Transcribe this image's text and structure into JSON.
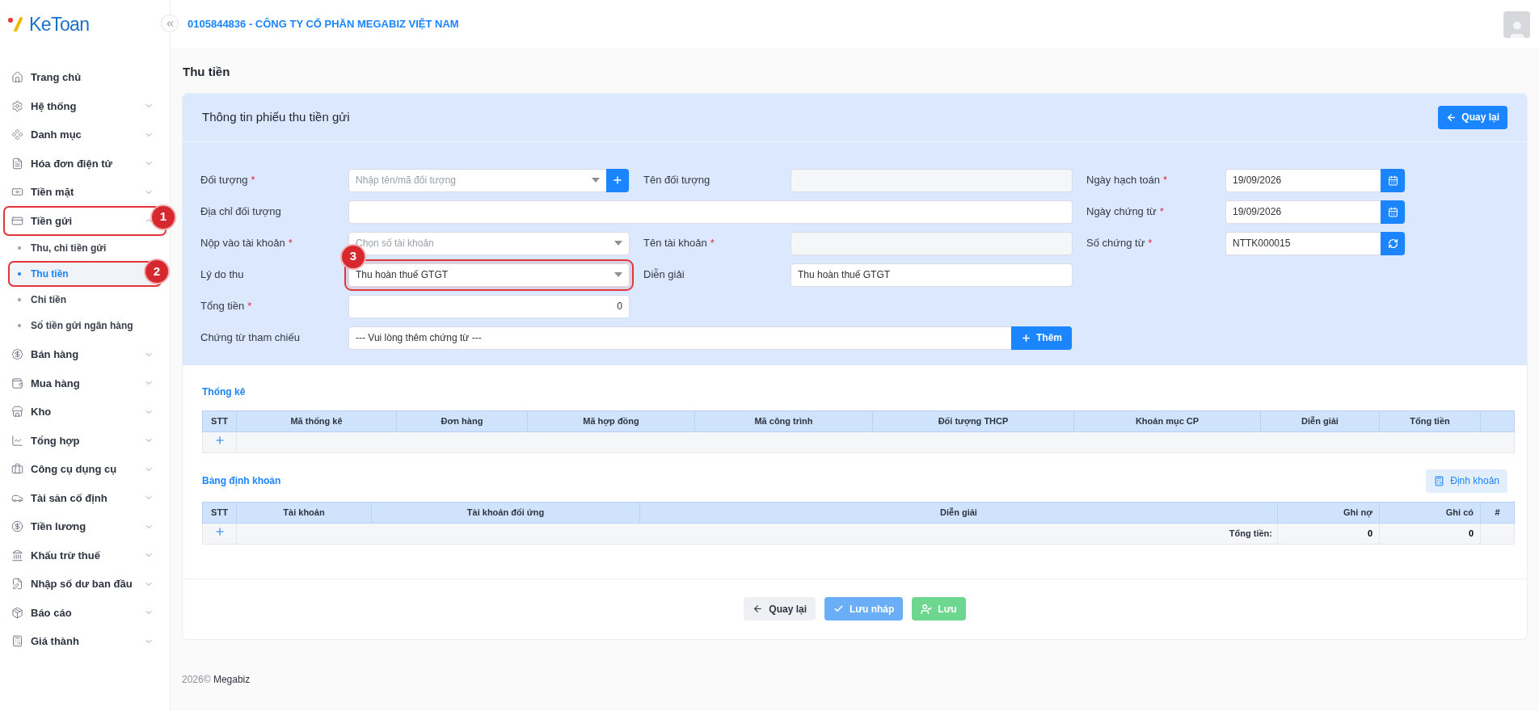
{
  "brand": {
    "name": "KeToan"
  },
  "header": {
    "company": "0105844836 - CÔNG TY CỔ PHẦN MEGABIZ VIỆT NAM"
  },
  "sidebar": {
    "items": [
      {
        "label": "Trang chủ"
      },
      {
        "label": "Hệ thống",
        "expanded": false
      },
      {
        "label": "Danh mục",
        "expanded": false
      },
      {
        "label": "Hóa đơn điện tử",
        "expanded": false
      },
      {
        "label": "Tiền mặt",
        "expanded": false
      },
      {
        "label": "Tiền gửi",
        "expanded": true,
        "callout": "1",
        "children": [
          {
            "label": "Thu, chi tiền gửi",
            "selected": false
          },
          {
            "label": "Thu tiền",
            "selected": true,
            "callout": "2"
          },
          {
            "label": "Chi tiền",
            "selected": false
          },
          {
            "label": "Sổ tiền gửi ngân hàng",
            "selected": false
          }
        ]
      },
      {
        "label": "Bán hàng",
        "expanded": false
      },
      {
        "label": "Mua hàng",
        "expanded": false
      },
      {
        "label": "Kho",
        "expanded": false
      },
      {
        "label": "Tổng hợp",
        "expanded": false
      },
      {
        "label": "Công cụ dụng cụ",
        "expanded": false
      },
      {
        "label": "Tài sản cố định",
        "expanded": false
      },
      {
        "label": "Tiền lương",
        "expanded": false
      },
      {
        "label": "Khấu trừ thuế",
        "expanded": false
      },
      {
        "label": "Nhập số dư ban đầu",
        "expanded": false
      },
      {
        "label": "Báo cáo",
        "expanded": false
      },
      {
        "label": "Giá thành",
        "expanded": false
      }
    ]
  },
  "page_title": "Thu tiền",
  "card": {
    "title": "Thông tin phiếu thu tiền gửi",
    "back_button": "Quay lại"
  },
  "required_mark": "*",
  "form": {
    "doi_tuong": {
      "label": "Đối tượng",
      "required": true,
      "placeholder": "Nhập tên/mã đối tượng"
    },
    "ten_doi_tuong": {
      "label": "Tên đối tượng",
      "required": false
    },
    "ngay_hach_toan": {
      "label": "Ngày hạch toán",
      "required": true,
      "value": "19/09/2026"
    },
    "dia_chi": {
      "label": "Địa chỉ đối tượng",
      "required": false
    },
    "ngay_chung_tu": {
      "label": "Ngày chứng từ",
      "required": true,
      "value": "19/09/2026"
    },
    "nop_vao": {
      "label": "Nộp vào tài khoản",
      "required": true,
      "placeholder": "Chọn số tài khoản"
    },
    "ten_tai_khoan": {
      "label": "Tên tài khoản",
      "required": true
    },
    "so_chung_tu": {
      "label": "Số chứng từ",
      "required": true,
      "value": "NTTK000015"
    },
    "ly_do": {
      "label": "Lý do thu",
      "required": false,
      "value": "Thu hoàn thuế GTGT",
      "callout": "3"
    },
    "dien_giai": {
      "label": "Diễn giải",
      "required": false,
      "value": "Thu hoàn thuế GTGT"
    },
    "tong_tien": {
      "label": "Tổng tiền",
      "required": true,
      "value": "0"
    },
    "chung_tu": {
      "label": "Chứng từ tham chiếu",
      "required": false,
      "placeholder": "--- Vui lòng thêm chứng từ ---",
      "button": "Thêm"
    }
  },
  "stats": {
    "title": "Thống kê",
    "columns": [
      "STT",
      "Mã thống kê",
      "Đơn hàng",
      "Mã hợp đồng",
      "Mã công trình",
      "Đối tượng THCP",
      "Khoản mục CP",
      "Diễn giải",
      "Tổng tiền"
    ]
  },
  "entries": {
    "title": "Bảng định khoản",
    "button": "Định khoản",
    "columns": [
      "STT",
      "Tài khoản",
      "Tài khoản đối ứng",
      "Diễn giải",
      "Ghi nợ",
      "Ghi có",
      "#"
    ],
    "total_label": "Tổng tiền:",
    "total_debit": "0",
    "total_credit": "0"
  },
  "actions": [
    {
      "kind": "back",
      "label": "Quay lại"
    },
    {
      "kind": "draft",
      "label": "Lưu nháp"
    },
    {
      "kind": "save",
      "label": "Lưu"
    }
  ],
  "footer": {
    "year": "2026©",
    "company": "Megabiz"
  }
}
